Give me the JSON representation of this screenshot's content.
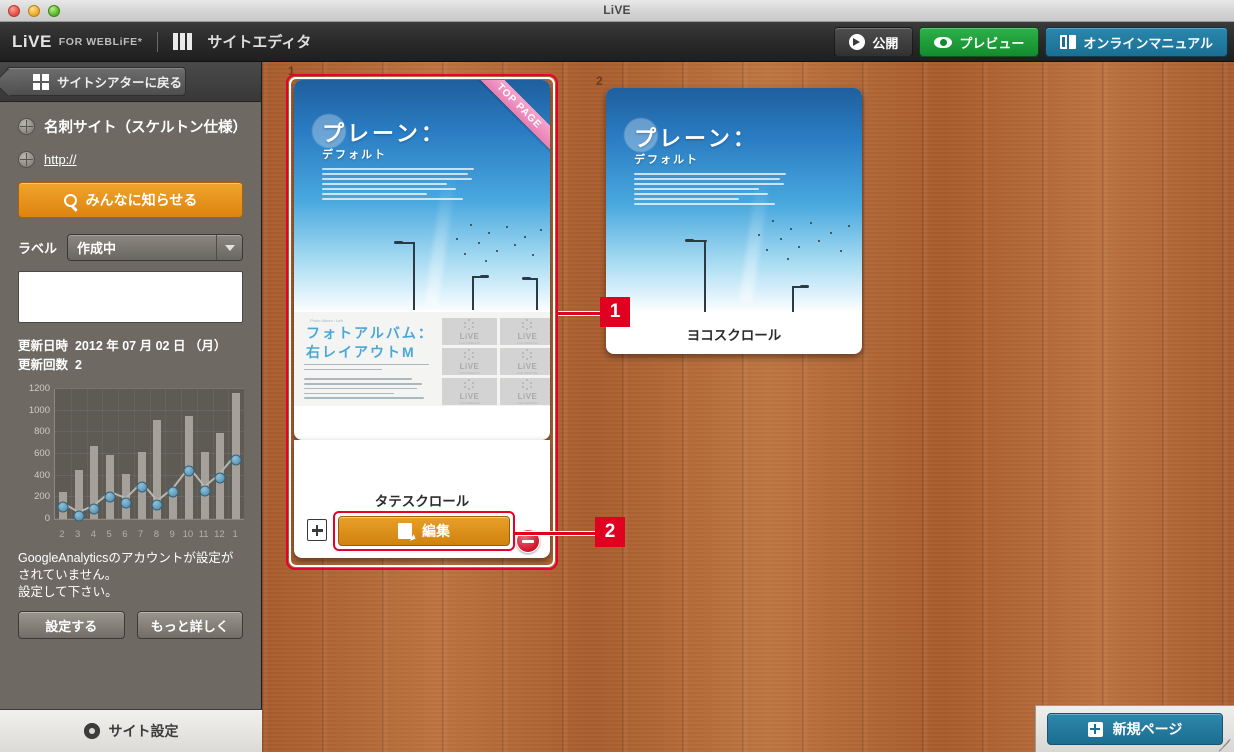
{
  "window": {
    "title": "LiVE"
  },
  "header": {
    "brand_live": "LiVE",
    "brand_sub": "FOR WEBLiFE*",
    "brand_editor": "サイトエディタ",
    "buttons": [
      {
        "label": "公開",
        "icon": "publish-icon",
        "color": "#3a3a3a"
      },
      {
        "label": "プレビュー",
        "icon": "eye-icon",
        "color": "#1e9b38"
      },
      {
        "label": "オンラインマニュアル",
        "icon": "book-icon",
        "color": "#2380aa"
      }
    ]
  },
  "sidebar": {
    "back_button": "サイトシアターに戻る",
    "site_title": "名刺サイト（スケルトン仕様）",
    "site_url": "http://",
    "share_button": "みんなに知らせる",
    "label_caption": "ラベル",
    "label_value": "作成中",
    "memo_value": "",
    "updated_label": "更新日時",
    "updated_value": "2012 年 07 月 02 日 （月）",
    "count_label": "更新回数",
    "count_value": "2",
    "ga_message": "GoogleAnalyticsのアカウントが設定がされていません。\n設定して下さい。",
    "ga_buttons": [
      "設定する",
      "もっと詳しく"
    ],
    "site_settings": "サイト設定"
  },
  "chart_data": {
    "type": "bar",
    "title": "",
    "xlabel": "",
    "ylabel": "",
    "categories": [
      "2",
      "3",
      "4",
      "5",
      "6",
      "7",
      "8",
      "9",
      "10",
      "11",
      "12",
      "1"
    ],
    "ylim": [
      0,
      1200
    ],
    "yticks": [
      0,
      200,
      400,
      600,
      800,
      1000,
      1200
    ],
    "grid": true,
    "legend": "none",
    "series": [
      {
        "name": "bars",
        "type": "bar",
        "values": [
          245,
          450,
          675,
          590,
          415,
          620,
          910,
          290,
          955,
          620,
          790,
          1160
        ]
      },
      {
        "name": "line",
        "type": "line",
        "values": [
          160,
          75,
          140,
          255,
          200,
          345,
          180,
          300,
          490,
          310,
          430,
          600
        ]
      }
    ]
  },
  "canvas": {
    "pages": [
      {
        "number": "1",
        "badge": "TOP PAGE",
        "thumb_title": "プレーン：",
        "thumb_sub": "デフォルト",
        "lower_kicker": "Photo Album : Left",
        "lower_title_1": "フォトアルバム：",
        "lower_title_2": "右レイアウトM",
        "placeholder_label": "LiVE",
        "placeholder_sub": "FOR WEBLiFE*",
        "caption": "タテスクロール",
        "edit_button": "編集",
        "add_icon": "add-page-icon",
        "delete_icon": "delete-page-icon",
        "selected": true
      },
      {
        "number": "2",
        "thumb_title": "プレーン：",
        "thumb_sub": "デフォルト",
        "caption": "ヨコスクロール",
        "selected": false
      }
    ],
    "annotations": [
      {
        "label": "1"
      },
      {
        "label": "2"
      }
    ],
    "new_page_button": "新規ページ"
  },
  "colors": {
    "accent_orange": "#dd8410",
    "accent_teal": "#1c6e91",
    "accent_green": "#138b2c",
    "annotation_red": "#e00020",
    "wood": "#b4632f"
  }
}
